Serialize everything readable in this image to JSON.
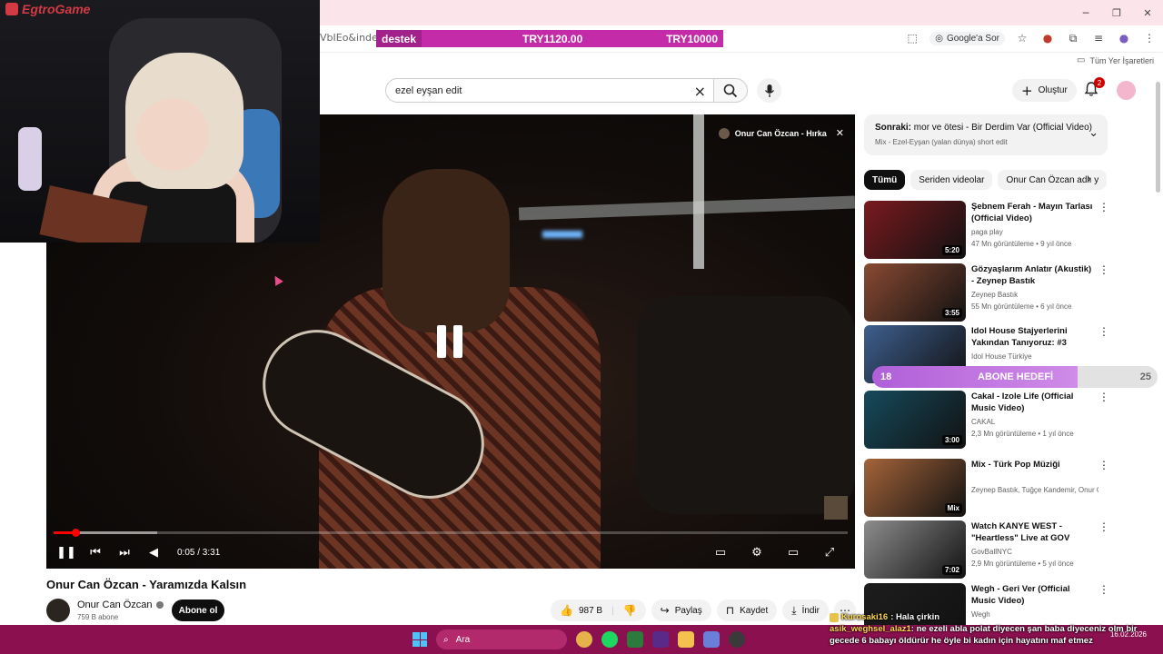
{
  "browser": {
    "url_fragment": "VbIEo&index=",
    "google_ask": "Google'a Sor",
    "bookmarks_all": "Tüm Yer İşaretleri"
  },
  "donation": {
    "label": "destek",
    "current": "TRY1120.00",
    "goal": "TRY10000"
  },
  "header": {
    "search_value": "ezel eyşan edit",
    "create_label": "Oluştur",
    "notification_count": "2"
  },
  "stream": {
    "logo_text": "EgtroGame"
  },
  "player": {
    "now_playing": "Onur Can Özcan - Hırka",
    "time": "0:05 / 3:31",
    "progress_fraction": 0.027,
    "buffer_fraction": 0.13
  },
  "video": {
    "title": "Onur Can Özcan - Yaramızda Kalsın",
    "channel": "Onur Can Özcan",
    "subscribers": "759 B abone",
    "subscribe_label": "Abone ol",
    "likes": "987 B",
    "share_label": "Paylaş",
    "save_label": "Kaydet",
    "download_label": "İndir"
  },
  "up_next": {
    "label": "Sonraki:",
    "title": "mor ve ötesi - Bir Derdim Var (Official Video)",
    "subtitle": "Mix - Ezel-Eyşan (yalan dünya) short edit"
  },
  "chips": [
    "Tümü",
    "Seriden videolar",
    "Onur Can Özcan adlı y"
  ],
  "recommendations": [
    {
      "title": "Şebnem Ferah - Mayın Tarlası (Official Video)",
      "channel": "paga play",
      "meta": "47 Mn görüntüleme • 9 yıl önce",
      "duration": "5:20",
      "color": "#7a1a1f"
    },
    {
      "title": "Gözyaşlarım Anlatır (Akustik) - Zeynep Bastık",
      "channel": "Zeynep Bastık",
      "meta": "55 Mn görüntüleme • 6 yıl önce",
      "duration": "3:55",
      "color": "#8a4a33"
    },
    {
      "title": "Idol House Stajyerlerini Yakından Tanıyoruz: #3 Görke...",
      "channel": "Idol House Türkiye",
      "meta": "",
      "duration": "",
      "color": "#3e5f8f"
    },
    {
      "title": "Cakal - Izole Life (Official Music Video)",
      "channel": "CAKAL",
      "meta": "2,3 Mn görüntüleme • 1 yıl önce",
      "duration": "3:00",
      "color": "#164a5c"
    },
    {
      "title": "Mix - Türk Pop Müziği",
      "channel": "Zeynep Bastık, Tuğçe Kandemir, Onur Ca...",
      "meta": "",
      "duration": "Mix",
      "color": "#a5643a"
    },
    {
      "title": "Watch KANYE WEST - \"Heartless\" Live at GOV BALL ...",
      "channel": "GovBallNYC",
      "meta": "2,9 Mn görüntüleme • 5 yıl önce",
      "duration": "7:02",
      "color": "#8d8d8d"
    },
    {
      "title": "Wegh - Geri Ver (Official Music Video)",
      "channel": "Wegh",
      "meta": "",
      "duration": "",
      "color": "#1d1d1d"
    }
  ],
  "sub_goal": {
    "current": "18",
    "label": "ABONE HEDEFİ",
    "target": "25",
    "fraction": 0.72
  },
  "taskbar": {
    "search_label": "Ara",
    "date": "16.02.2026"
  },
  "chat": [
    {
      "user": "Kurosaki16",
      "message": ": Hala çirkin"
    },
    {
      "user": "asik_weghsel_alaz1",
      "message": ": ne ezeli abla polat diyecen şan baba diyeceniz olm bir gecede 6 babayı öldürür he öyle bi kadın için hayatını maf etmez"
    }
  ]
}
